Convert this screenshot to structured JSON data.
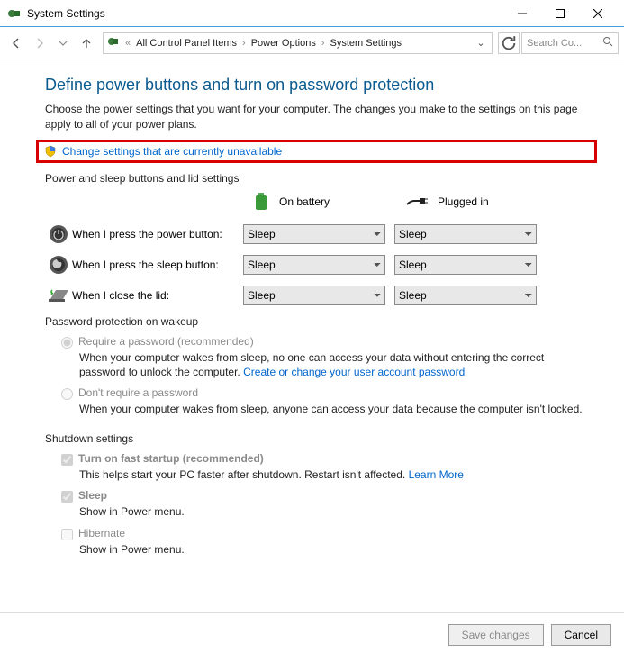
{
  "window": {
    "title": "System Settings"
  },
  "breadcrumb": {
    "root_icon": "control-panel",
    "item1": "All Control Panel Items",
    "item2": "Power Options",
    "item3": "System Settings"
  },
  "search": {
    "placeholder": "Search Co..."
  },
  "page": {
    "title": "Define power buttons and turn on password protection",
    "desc": "Choose the power settings that you want for your computer. The changes you make to the settings on this page apply to all of your power plans.",
    "change_link": "Change settings that are currently unavailable"
  },
  "sections": {
    "buttons_head": "Power and sleep buttons and lid settings",
    "col_battery": "On battery",
    "col_plugged": "Plugged in",
    "rows": {
      "power": {
        "label": "When I press the power button:",
        "battery": "Sleep",
        "plugged": "Sleep"
      },
      "sleep": {
        "label": "When I press the sleep button:",
        "battery": "Sleep",
        "plugged": "Sleep"
      },
      "lid": {
        "label": "When I close the lid:",
        "battery": "Sleep",
        "plugged": "Sleep"
      }
    },
    "password_head": "Password protection on wakeup",
    "pw_req": {
      "label": "Require a password (recommended)",
      "desc_a": "When your computer wakes from sleep, no one can access your data without entering the correct password to unlock the computer. ",
      "link": "Create or change your user account password"
    },
    "pw_no": {
      "label": "Don't require a password",
      "desc": "When your computer wakes from sleep, anyone can access your data because the computer isn't locked."
    },
    "shutdown_head": "Shutdown settings",
    "fast": {
      "label": "Turn on fast startup (recommended)",
      "desc_a": "This helps start your PC faster after shutdown. Restart isn't affected. ",
      "link": "Learn More"
    },
    "sleepchk": {
      "label": "Sleep",
      "desc": "Show in Power menu."
    },
    "hib": {
      "label": "Hibernate",
      "desc": "Show in Power menu."
    }
  },
  "footer": {
    "save": "Save changes",
    "cancel": "Cancel"
  }
}
